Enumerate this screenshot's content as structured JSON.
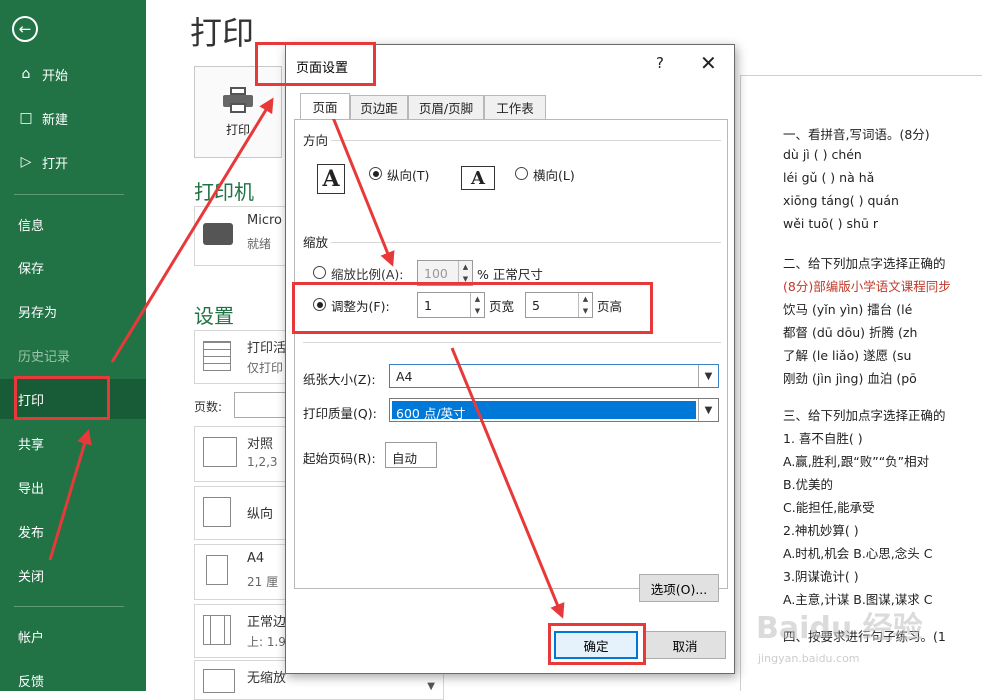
{
  "sidebar": {
    "back_icon": "back-arrow-icon",
    "items": [
      {
        "label": "开始",
        "icon": "home-icon"
      },
      {
        "label": "新建",
        "icon": "new-doc-icon"
      },
      {
        "label": "打开",
        "icon": "open-folder-icon"
      },
      {
        "label": "信息"
      },
      {
        "label": "保存"
      },
      {
        "label": "另存为"
      },
      {
        "label": "历史记录"
      },
      {
        "label": "打印"
      },
      {
        "label": "共享"
      },
      {
        "label": "导出"
      },
      {
        "label": "发布"
      },
      {
        "label": "关闭"
      },
      {
        "label": "帐户"
      },
      {
        "label": "反馈"
      }
    ],
    "bg_color": "#217346"
  },
  "print_pane": {
    "title": "打印",
    "print_button": "打印",
    "printer_heading": "打印机",
    "printer_name": "Micro",
    "printer_status": "就绪",
    "settings_heading": "设置",
    "settings": [
      {
        "main": "打印活",
        "sub": "仅打印"
      },
      {
        "main": "对照",
        "sub": "1,2,3"
      },
      {
        "main": "纵向",
        "sub": ""
      },
      {
        "main": "A4",
        "sub": "21 厘"
      },
      {
        "main": "正常边",
        "sub": "上: 1.9"
      },
      {
        "main": "无缩放",
        "sub": ""
      }
    ],
    "pages_label": "页数:"
  },
  "dialog": {
    "title": "页面设置",
    "help": "?",
    "close": "✕",
    "tabs": [
      "页面",
      "页边距",
      "页眉/页脚",
      "工作表"
    ],
    "orientation": {
      "label": "方向",
      "portrait": "纵向(T)",
      "landscape": "横向(L)",
      "portrait_glyph": "A",
      "landscape_glyph": "A"
    },
    "scaling": {
      "label": "缩放",
      "adjust_pct_label": "缩放比例(A):",
      "adjust_pct_value": "100",
      "adjust_pct_suffix": "% 正常尺寸",
      "fit_label": "调整为(F):",
      "fit_wide": "1",
      "fit_wide_suffix": "页宽",
      "fit_tall": "5",
      "fit_tall_suffix": "页高"
    },
    "paper_size_label": "纸张大小(Z):",
    "paper_size_value": "A4",
    "print_quality_label": "打印质量(Q):",
    "print_quality_value": "600 点/英寸",
    "first_page_label": "起始页码(R):",
    "first_page_value": "自动",
    "options_button": "选项(O)...",
    "ok_button": "确定",
    "cancel_button": "取消"
  },
  "preview": {
    "lines": [
      "一、看拼音,写词语。(8分)",
      "dù jì (          )            chén",
      "léi gǔ (         )            nà hǎ",
      "xiōng táng(       )          quán",
      "wěi tuō(        )             shū r",
      "",
      "二、给下列加点字选择正确的",
      "(8分)部编版小学语文课程同步",
      "饮马 (yǐn  yìn)         擂台 (lé",
      "都督 (dū  dōu)          折腾 (zh",
      "了解 (le  liǎo)          遂愿 (su",
      "刚劲 (jìn  jìng)         血泊 (pō",
      "",
      "三、给下列加点字选择正确的",
      "1. 喜不自胜(      )",
      "A.赢,胜利,跟“败”“负”相对",
      "B.优美的",
      "C.能担任,能承受",
      "2.神机妙算(      )",
      "A.时机,机会   B.心思,念头   C",
      "3.阴谋诡计(      )",
      "A.主意,计谋   B.图谋,谋求   C",
      "",
      "四、按要求进行句子练习。(1"
    ]
  },
  "watermark": {
    "main": "Baidu 经验",
    "sub": "jingyan.baidu.com"
  },
  "annotation_color": "#e8393a"
}
